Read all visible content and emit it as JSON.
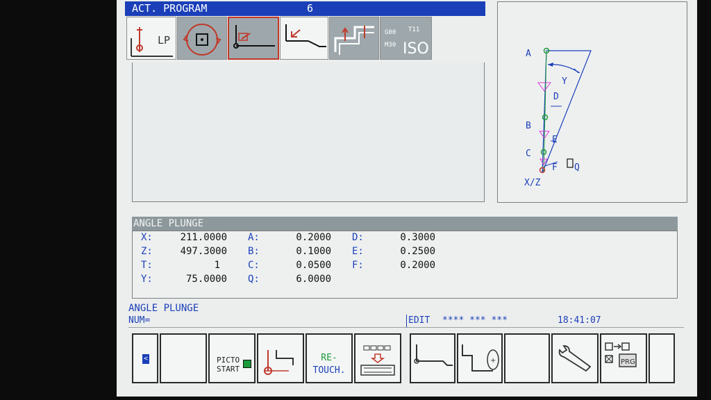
{
  "header": {
    "title": "ACT. PROGRAM",
    "program_number": "6"
  },
  "toolbar": {
    "items": [
      {
        "icon": "lathe-path-lp-icon",
        "label": "LP"
      },
      {
        "icon": "rotation-icon"
      },
      {
        "icon": "angle-plunge-icon"
      },
      {
        "icon": "angle-entry-icon"
      },
      {
        "icon": "step-profile-icon"
      },
      {
        "icon": "iso-code-icon",
        "label_g": "G00",
        "label_t": "T11",
        "label_m": "M30",
        "label_iso": "ISO"
      }
    ]
  },
  "diagram": {
    "labels": {
      "a": "A",
      "b": "B",
      "c": "C",
      "d": "D",
      "e": "E",
      "f": "F",
      "y": "Y",
      "q": "Q",
      "xz": "X/Z"
    }
  },
  "params": {
    "header": "ANGLE PLUNGE",
    "col1": [
      {
        "label": "X:",
        "value": "211.0000"
      },
      {
        "label": "Z:",
        "value": "497.3000"
      },
      {
        "label": "T:",
        "value": "1"
      },
      {
        "label": "Y:",
        "value": "75.0000"
      }
    ],
    "col2": [
      {
        "label": "A:",
        "value": "0.2000"
      },
      {
        "label": "B:",
        "value": "0.1000"
      },
      {
        "label": "C:",
        "value": "0.0500"
      },
      {
        "label": "Q:",
        "value": "6.0000"
      }
    ],
    "col3": [
      {
        "label": "D:",
        "value": "0.3000"
      },
      {
        "label": "E:",
        "value": "0.2500"
      },
      {
        "label": "F:",
        "value": "0.2000"
      }
    ]
  },
  "status": {
    "message": "ANGLE PLUNGE",
    "num_label": "NUM=",
    "mode": "EDIT",
    "flags": "**** *** ***",
    "time": "18:41:07"
  },
  "softkeys": {
    "picto_start": "PICTO\nSTART",
    "retouch_1": "RE-",
    "retouch_2": "TOUCH.",
    "prg": "PRG"
  },
  "colors": {
    "blue": "#1a3fb8",
    "red": "#c0392b",
    "green": "#1b9a3a",
    "magenta": "#d63bd6"
  }
}
